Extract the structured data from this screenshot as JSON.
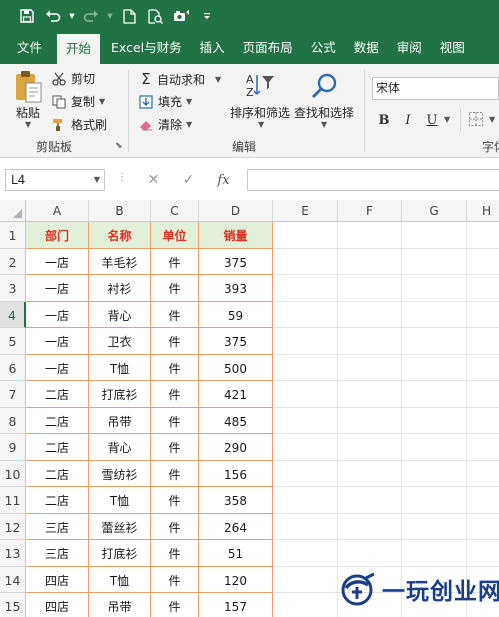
{
  "quick_access": {
    "icons": [
      "save-icon",
      "undo-icon",
      "redo-icon",
      "new-file-icon",
      "print-preview-icon",
      "camera-icon",
      "customize-icon"
    ]
  },
  "tabs": [
    {
      "label": "文件",
      "active": false
    },
    {
      "label": "开始",
      "active": true
    },
    {
      "label": "Excel与财务",
      "active": false
    },
    {
      "label": "插入",
      "active": false
    },
    {
      "label": "页面布局",
      "active": false
    },
    {
      "label": "公式",
      "active": false
    },
    {
      "label": "数据",
      "active": false
    },
    {
      "label": "审阅",
      "active": false
    },
    {
      "label": "视图",
      "active": false
    }
  ],
  "ribbon": {
    "paste": "粘贴",
    "cut": "剪切",
    "copy": "复制",
    "format_painter": "格式刷",
    "clipboard_group": "剪贴板",
    "autosum": "自动求和",
    "fill": "填充",
    "clear": "清除",
    "sort_filter": "排序和筛选",
    "find_select": "查找和选择",
    "editing_group": "编辑",
    "font_name": "宋体",
    "bold": "B",
    "italic": "I",
    "underline": "U",
    "font_group": "字体"
  },
  "formula_bar": {
    "name_box": "L4",
    "formula": ""
  },
  "columns": [
    "A",
    "B",
    "C",
    "D",
    "E",
    "F",
    "G",
    "H"
  ],
  "rows": [
    "1",
    "2",
    "3",
    "4",
    "5",
    "6",
    "7",
    "8",
    "9",
    "10",
    "11",
    "12",
    "13",
    "14",
    "15"
  ],
  "selected_row": "4",
  "table": {
    "headers": [
      "部门",
      "名称",
      "单位",
      "销量"
    ],
    "rows": [
      [
        "一店",
        "羊毛衫",
        "件",
        "375"
      ],
      [
        "一店",
        "衬衫",
        "件",
        "393"
      ],
      [
        "一店",
        "背心",
        "件",
        "59"
      ],
      [
        "一店",
        "卫衣",
        "件",
        "375"
      ],
      [
        "一店",
        "T恤",
        "件",
        "500"
      ],
      [
        "二店",
        "打底衫",
        "件",
        "421"
      ],
      [
        "二店",
        "吊带",
        "件",
        "485"
      ],
      [
        "二店",
        "背心",
        "件",
        "290"
      ],
      [
        "二店",
        "雪纺衫",
        "件",
        "156"
      ],
      [
        "二店",
        "T恤",
        "件",
        "358"
      ],
      [
        "三店",
        "蕾丝衫",
        "件",
        "264"
      ],
      [
        "三店",
        "打底衫",
        "件",
        "51"
      ],
      [
        "四店",
        "T恤",
        "件",
        "120"
      ],
      [
        "四店",
        "吊带",
        "件",
        "157"
      ]
    ]
  },
  "watermark": "一玩创业网",
  "colors": {
    "excel_green": "#217346",
    "header_fill": "#e2efda",
    "header_text": "#e0301e",
    "table_border": "#f0a06a"
  }
}
